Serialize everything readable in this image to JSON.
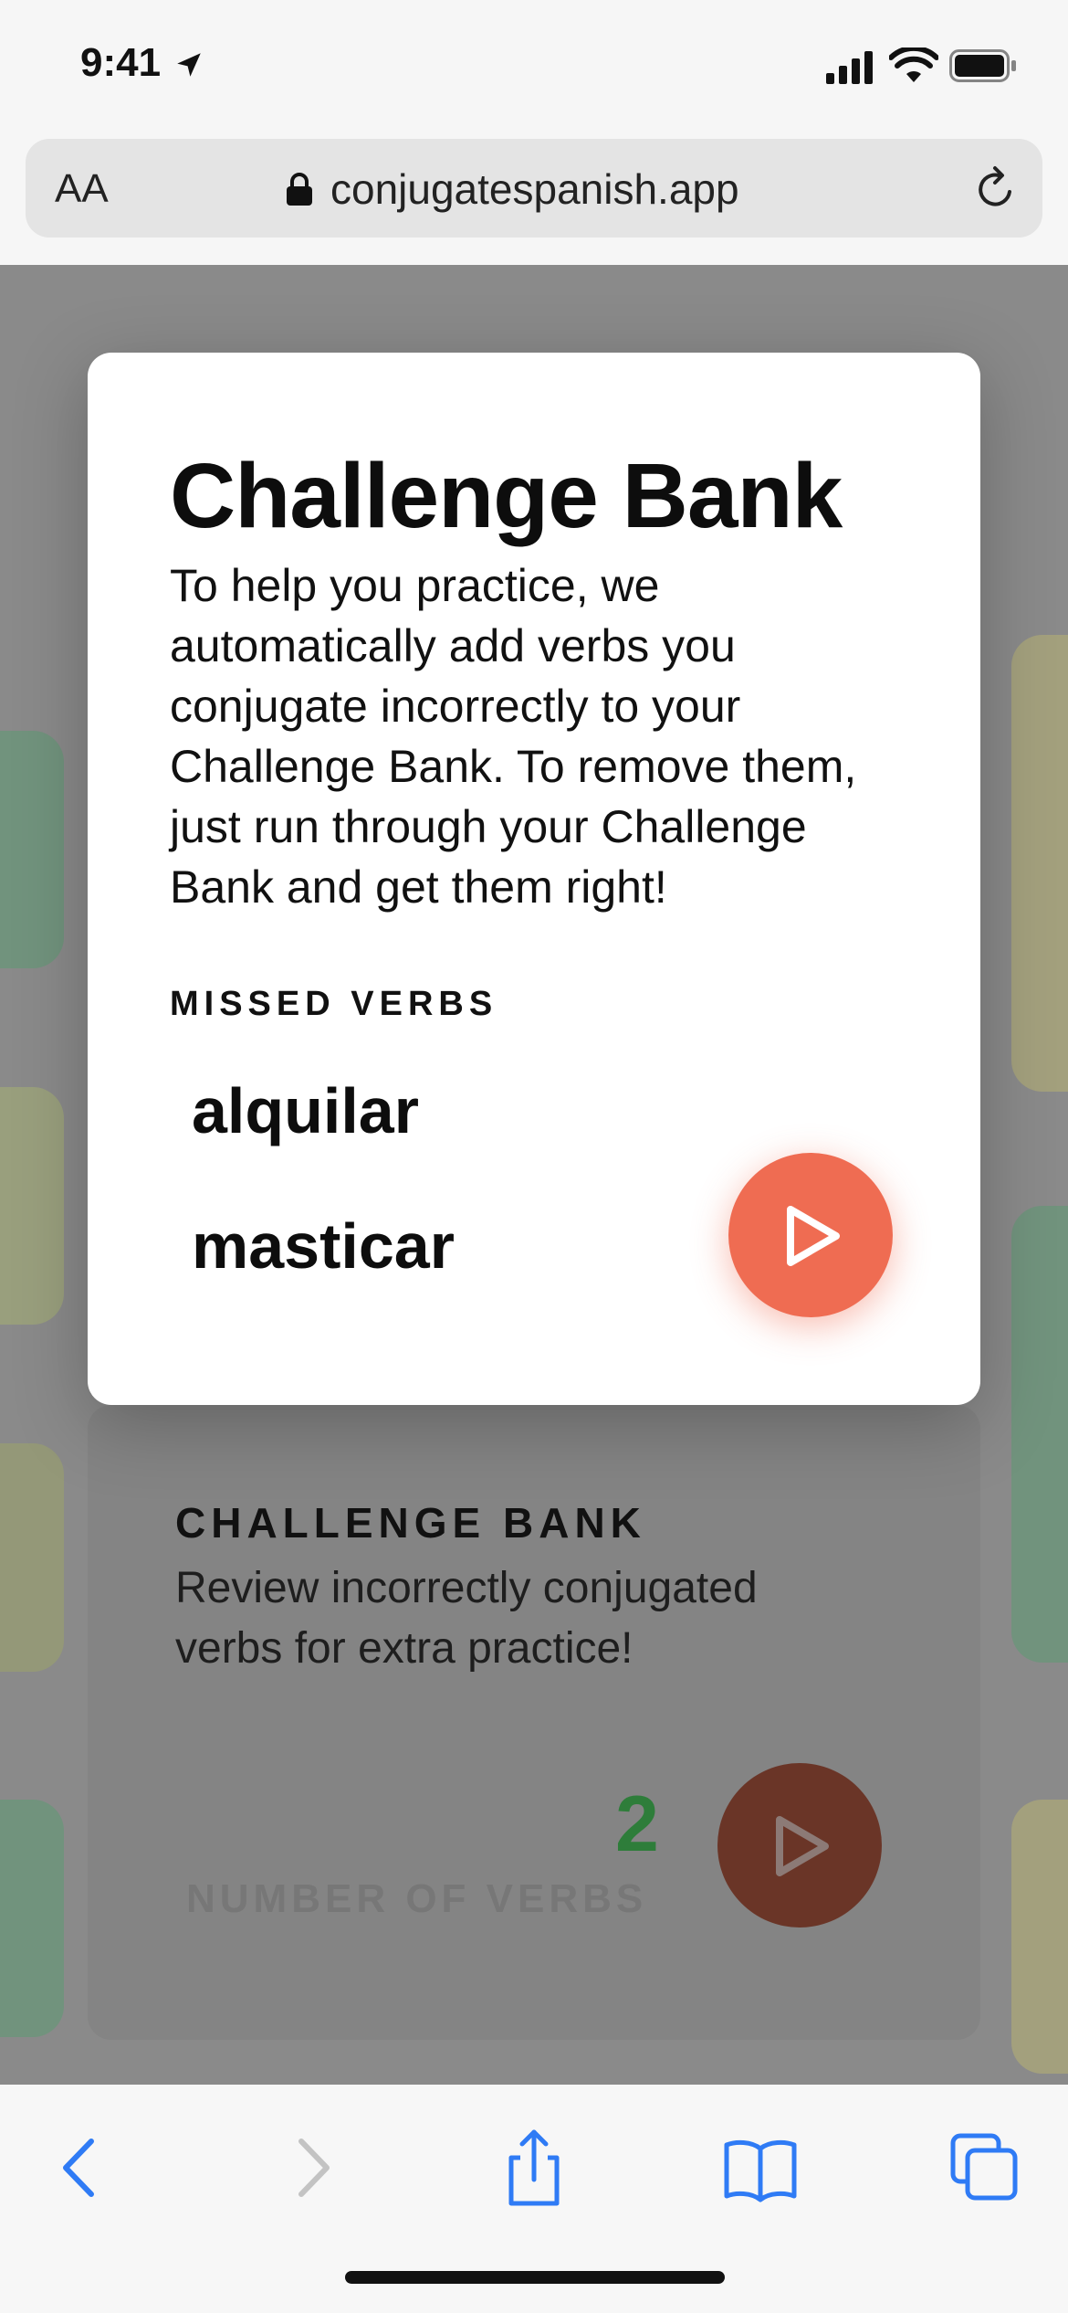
{
  "status_bar": {
    "time": "9:41"
  },
  "browser": {
    "text_size_label": "AA",
    "url": "conjugatespanish.app"
  },
  "modal": {
    "title": "Challenge Bank",
    "description": "To help you practice, we automatically add verbs you conjugate incorrectly to your Challenge Bank. To remove them, just run through your Challenge Bank and get them right!",
    "section_label": "MISSED VERBS",
    "verbs": [
      "alquilar",
      "masticar"
    ],
    "accent_color": "#ef6c52"
  },
  "background_card": {
    "title": "CHALLENGE BANK",
    "description": "Review incorrectly conjugated verbs for extra practice!",
    "count": "2",
    "count_label": "NUMBER OF VERBS"
  }
}
